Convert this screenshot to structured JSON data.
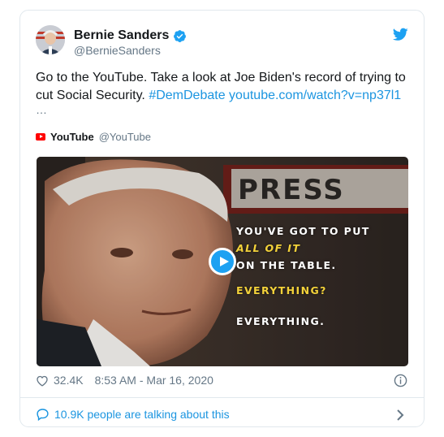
{
  "author": {
    "name": "Bernie Sanders",
    "handle": "@BernieSanders"
  },
  "tweet": {
    "text": "Go to the YouTube. Take a look at Joe Biden's record of trying to cut Social Security. ",
    "hashtag": "#DemDebate",
    "link": "youtube.com/watch?v=np37l1",
    "ellipsis": "…"
  },
  "embed": {
    "source_name": "YouTube",
    "source_handle": "@YouTube",
    "video": {
      "overlay_lines": [
        "YOU'VE GOT TO PUT",
        "ALL OF IT",
        "ON THE TABLE.",
        "EVERYTHING?",
        "EVERYTHING."
      ],
      "background_sign": "PRESS"
    }
  },
  "meta": {
    "likes": "32.4K",
    "timestamp": "8:53 AM - Mar 16, 2020"
  },
  "footer": {
    "talking": "10.9K people are talking about this"
  },
  "colors": {
    "link": "#1b95e0",
    "twitter_blue": "#1da1f2",
    "youtube_red": "#ff0000"
  },
  "icons": [
    "twitter-bird-icon",
    "verified-badge-icon",
    "youtube-logo-icon",
    "play-icon",
    "heart-icon",
    "info-icon",
    "speech-bubble-icon",
    "chevron-right-icon"
  ]
}
